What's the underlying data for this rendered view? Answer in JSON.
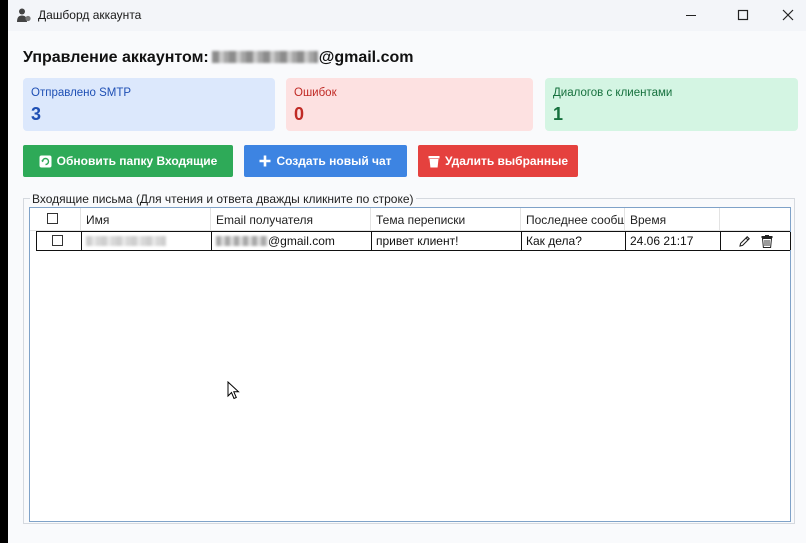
{
  "window": {
    "title": "Дашборд аккаунта",
    "icon": "user-icon",
    "controls": [
      "minimize-icon",
      "maximize-icon",
      "close-icon"
    ]
  },
  "header": {
    "prefix": "Управление аккаунтом:",
    "email_suffix": "@gmail.com"
  },
  "stats": [
    {
      "label": "Отправлено SMTP",
      "value": "3",
      "color": "#1e4fb4",
      "bg": "#dce8fc"
    },
    {
      "label": "Ошибок",
      "value": "0",
      "color": "#c02a25",
      "bg": "#fde1e1"
    },
    {
      "label": "Диалогов с клиентами",
      "value": "1",
      "color": "#15703d",
      "bg": "#d4f5e3"
    }
  ],
  "actions": {
    "refresh": {
      "label": "Обновить папку Входящие",
      "color": "#2eaa58"
    },
    "new_chat": {
      "label": "Создать новый чат",
      "color": "#3d84e2"
    },
    "delete": {
      "label": "Удалить выбранные",
      "color": "#e5413e"
    }
  },
  "inbox": {
    "legend": "Входящие письма (Для чтения и ответа дважды кликните по строке)",
    "columns": [
      "Имя",
      "Email получателя",
      "Тема переписки",
      "Последнее сообщ",
      "Время"
    ],
    "rows": [
      {
        "email_suffix": "@gmail.com",
        "subject": "привет клиент!",
        "last_message": "Как дела?",
        "time": "24.06 21:17"
      }
    ]
  }
}
